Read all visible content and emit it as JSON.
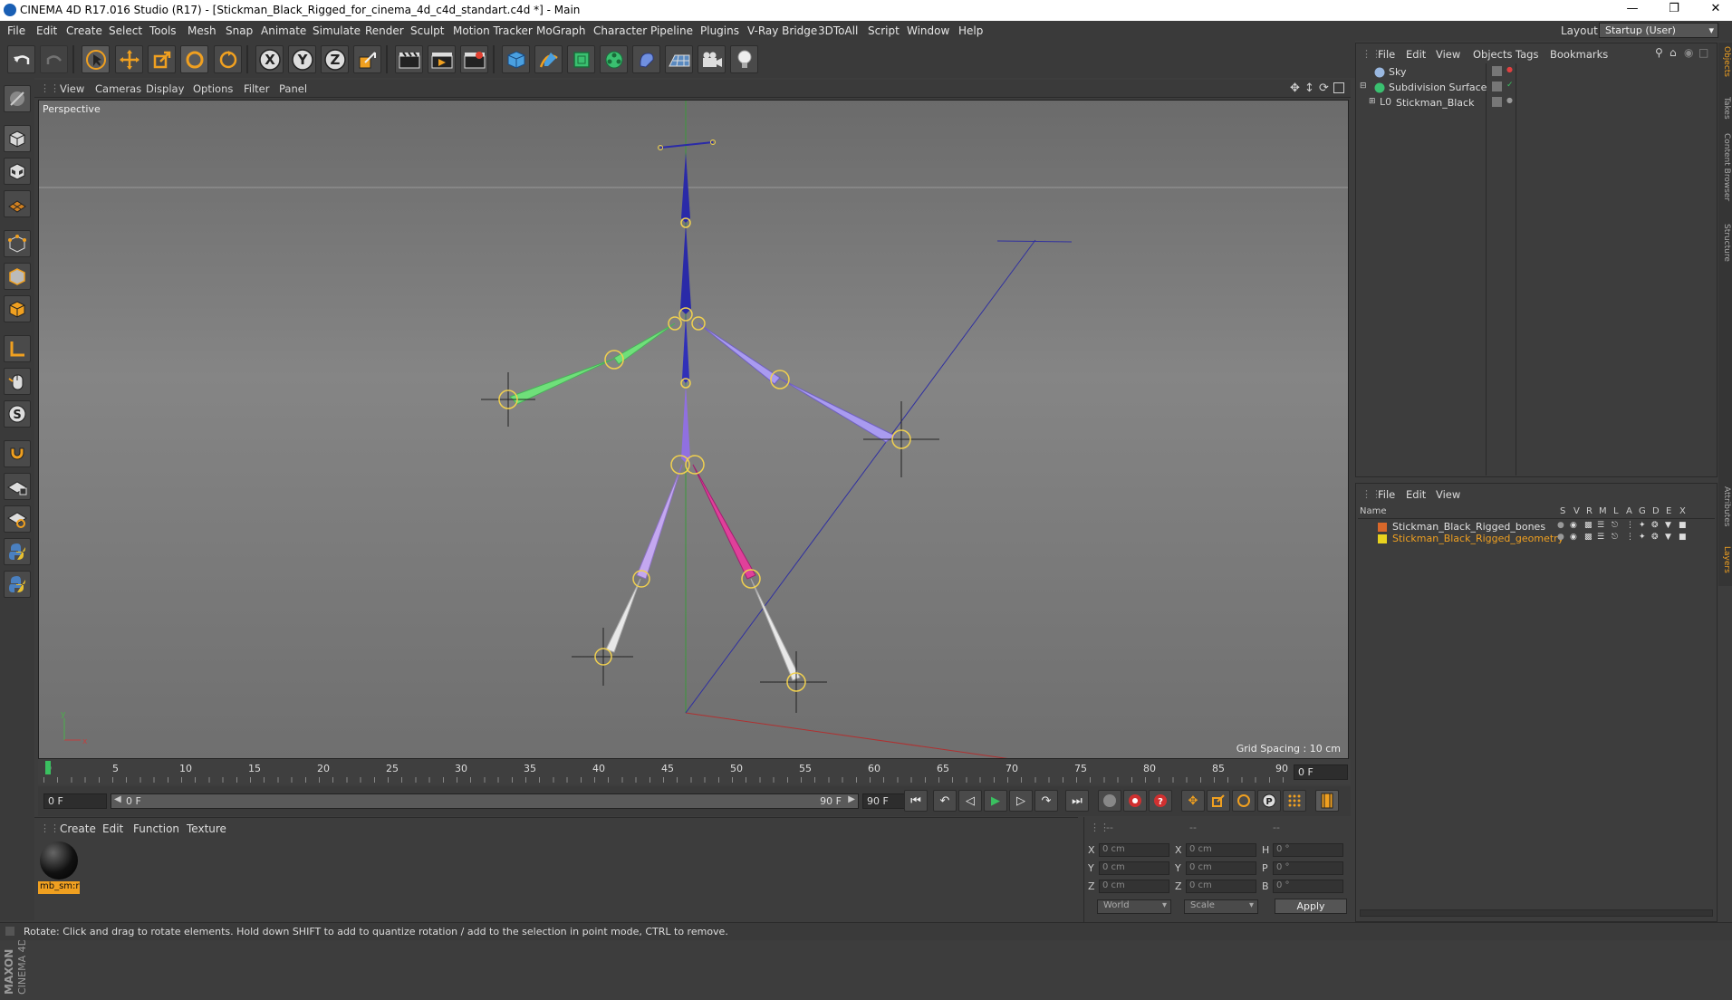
{
  "window": {
    "title": "CINEMA 4D R17.016 Studio (R17) - [Stickman_Black_Rigged_for_cinema_4d_c4d_standart.c4d *] - Main"
  },
  "menubar": [
    "File",
    "Edit",
    "Create",
    "Select",
    "Tools",
    "Mesh",
    "Snap",
    "Animate",
    "Simulate",
    "Render",
    "Sculpt",
    "Motion Tracker",
    "MoGraph",
    "Character",
    "Pipeline",
    "Plugins",
    "V-Ray Bridge",
    "3DToAll",
    "Script",
    "Window",
    "Help"
  ],
  "layout": {
    "label": "Layout:",
    "value": "Startup (User)"
  },
  "viewport": {
    "menu": [
      "View",
      "Cameras",
      "Display",
      "Options",
      "Filter",
      "Panel"
    ],
    "camera_label": "Perspective",
    "grid_spacing": "Grid Spacing : 10 cm"
  },
  "timeline": {
    "ticks": [
      "0",
      "5",
      "10",
      "15",
      "20",
      "25",
      "30",
      "35",
      "40",
      "45",
      "50",
      "55",
      "60",
      "65",
      "70",
      "75",
      "80",
      "85",
      "90"
    ],
    "current_frame": "0 F",
    "start_field": "0 F",
    "range_start": "0 F",
    "range_end": "90 F",
    "end_field": "90 F"
  },
  "materials": {
    "menu": [
      "Create",
      "Edit",
      "Function",
      "Texture"
    ],
    "items": [
      {
        "name": "mb_sm:r"
      }
    ]
  },
  "coords": {
    "headers": [
      "--",
      "--",
      "--"
    ],
    "rows": [
      {
        "a": "X",
        "av": "0 cm",
        "b": "X",
        "bv": "0 cm",
        "c": "H",
        "cv": "0 °"
      },
      {
        "a": "Y",
        "av": "0 cm",
        "b": "Y",
        "bv": "0 cm",
        "c": "P",
        "cv": "0 °"
      },
      {
        "a": "Z",
        "av": "0 cm",
        "b": "Z",
        "bv": "0 cm",
        "c": "B",
        "cv": "0 °"
      }
    ],
    "space": "World",
    "mode": "Scale",
    "apply": "Apply"
  },
  "objects": {
    "menu": [
      "File",
      "Edit",
      "View",
      "Objects",
      "Tags",
      "Bookmarks"
    ],
    "items": [
      {
        "name": "Sky"
      },
      {
        "name": "Subdivision Surface"
      },
      {
        "name": "Stickman_Black"
      }
    ]
  },
  "layers": {
    "menu": [
      "File",
      "Edit",
      "View"
    ],
    "header_name": "Name",
    "flags": [
      "S",
      "V",
      "R",
      "M",
      "L",
      "A",
      "G",
      "D",
      "E",
      "X"
    ],
    "items": [
      {
        "name": "Stickman_Black_Rigged_bones",
        "color": "#d9682a",
        "text_color": "#e0e0e0"
      },
      {
        "name": "Stickman_Black_Rigged_geometry",
        "color": "#e8d21e",
        "text_color": "#f0a020"
      }
    ]
  },
  "side_tabs": [
    "Objects",
    "Takes",
    "Content Browser",
    "Structure"
  ],
  "side_tabs_lower": [
    "Attributes",
    "Layers"
  ],
  "logo": {
    "line1": "MAXON",
    "line2": "CINEMA 4D"
  },
  "status": "Rotate: Click and drag to rotate elements. Hold down SHIFT to add to quantize rotation / add to the selection in point mode, CTRL to remove.",
  "colors": {
    "accent": "#f0a020",
    "bone_blue": "#2a2aa8",
    "bone_green": "#6fe07a",
    "bone_violet": "#a99bf0",
    "bone_pink": "#e0409a",
    "bone_white": "#e8e8e8",
    "joint": "#f0d050"
  }
}
